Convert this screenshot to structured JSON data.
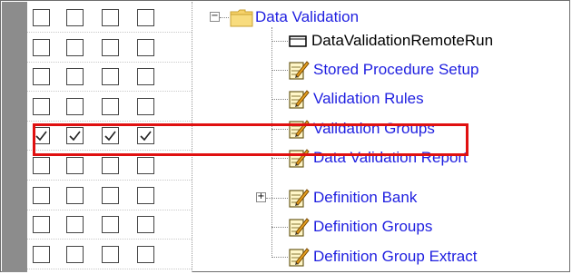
{
  "checkbox_grid": {
    "rows": [
      {
        "checks": [
          false,
          false,
          false,
          false
        ]
      },
      {
        "checks": [
          false,
          false,
          false,
          false
        ]
      },
      {
        "checks": [
          false,
          false,
          false,
          false
        ]
      },
      {
        "checks": [
          false,
          false,
          false,
          false
        ]
      },
      {
        "checks": [
          true,
          true,
          true,
          true
        ]
      },
      {
        "checks": [
          false,
          false,
          false,
          false
        ]
      },
      {
        "checks": [
          false,
          false,
          false,
          false
        ]
      },
      {
        "checks": [
          false,
          false,
          false,
          false
        ]
      },
      {
        "checks": [
          false,
          false,
          false,
          false
        ]
      }
    ]
  },
  "tree": {
    "root": {
      "label": "Data Validation",
      "icon": "folder-icon",
      "expanded": true
    },
    "children": [
      {
        "label": "DataValidationRemoteRun",
        "icon": "shortcut-icon"
      },
      {
        "label": "Stored Procedure Setup",
        "icon": "edit-note-icon"
      },
      {
        "label": "Validation Rules",
        "icon": "edit-note-icon"
      },
      {
        "label": "Validation Groups",
        "icon": "edit-note-icon",
        "highlighted": true
      },
      {
        "label": "Data Validation Report",
        "icon": "edit-note-icon"
      },
      {
        "label": "Definition Bank",
        "icon": "edit-note-icon",
        "expandable": true
      },
      {
        "label": "Definition Groups",
        "icon": "edit-note-icon"
      },
      {
        "label": "Definition Group Extract",
        "icon": "edit-note-icon"
      }
    ]
  },
  "colors": {
    "link": "#1f1fe0",
    "highlight_border": "#e01010",
    "strip": "#8c8c8c"
  }
}
